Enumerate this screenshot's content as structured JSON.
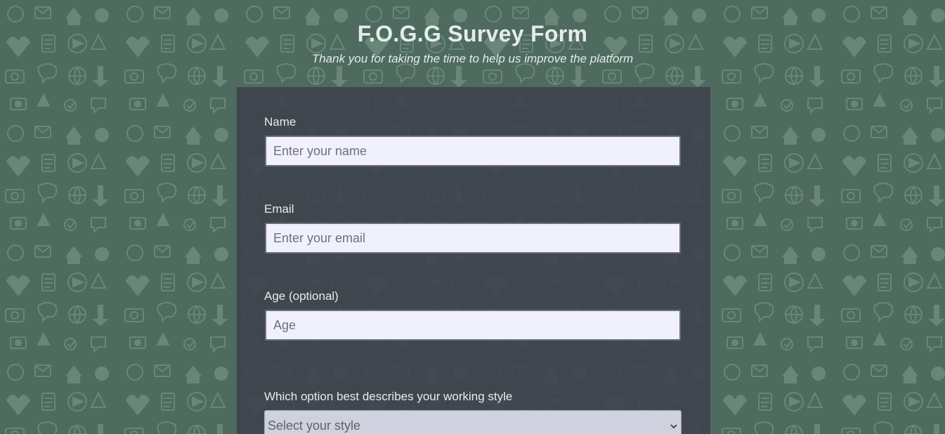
{
  "header": {
    "title": "F.O.G.G Survey Form",
    "subtitle": "Thank you for taking the time to help us improve the platform"
  },
  "form": {
    "name": {
      "label": "Name",
      "placeholder": "Enter your name",
      "value": ""
    },
    "email": {
      "label": "Email",
      "placeholder": "Enter your email",
      "value": ""
    },
    "age": {
      "label": "Age (optional)",
      "placeholder": "Age",
      "value": ""
    },
    "working_style": {
      "label": "Which option best describes your working style",
      "selected": "Select your style",
      "icon": "chevron-down-icon"
    }
  },
  "colors": {
    "background": "#4f6b5f",
    "card": "#3e434d",
    "input_bg": "#f1f1fe",
    "select_bg": "#cfd1de",
    "text_light": "#e4ecec"
  }
}
